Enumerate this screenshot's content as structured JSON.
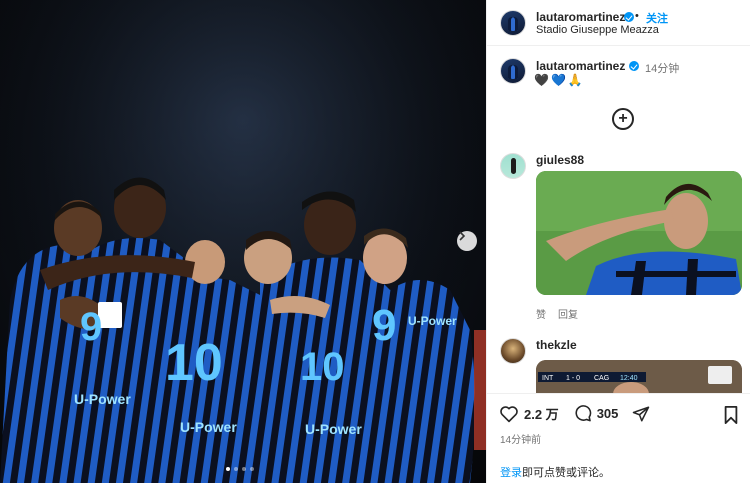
{
  "post": {
    "username": "lautaromartinez",
    "follow_label": "关注",
    "separator": "•",
    "location": "Stadio Giuseppe Meazza",
    "caption_time": "14分钟",
    "caption_emojis": [
      "🖤",
      "💙",
      "🙏"
    ],
    "likes": "2.2 万",
    "comments_count": "305",
    "posted_ago": "14分钟前",
    "login_link": "登录",
    "login_suffix": "即可点赞或评论。"
  },
  "media": {
    "carousel_dots": 4,
    "active_dot": 0,
    "jersey_numbers": [
      "10",
      "9",
      "10",
      "9"
    ],
    "sponsor_text": "U-Power"
  },
  "comments": [
    {
      "username": "giules88",
      "like_label": "赞",
      "reply_label": "回复"
    },
    {
      "username": "thekzle",
      "scoreboard": [
        "INT",
        "1 - 0",
        "CAG",
        "12:40"
      ]
    }
  ],
  "colors": {
    "accent": "#0095f6",
    "inter_blue": "#1f5cc4",
    "text": "#262626",
    "muted": "#737373"
  }
}
